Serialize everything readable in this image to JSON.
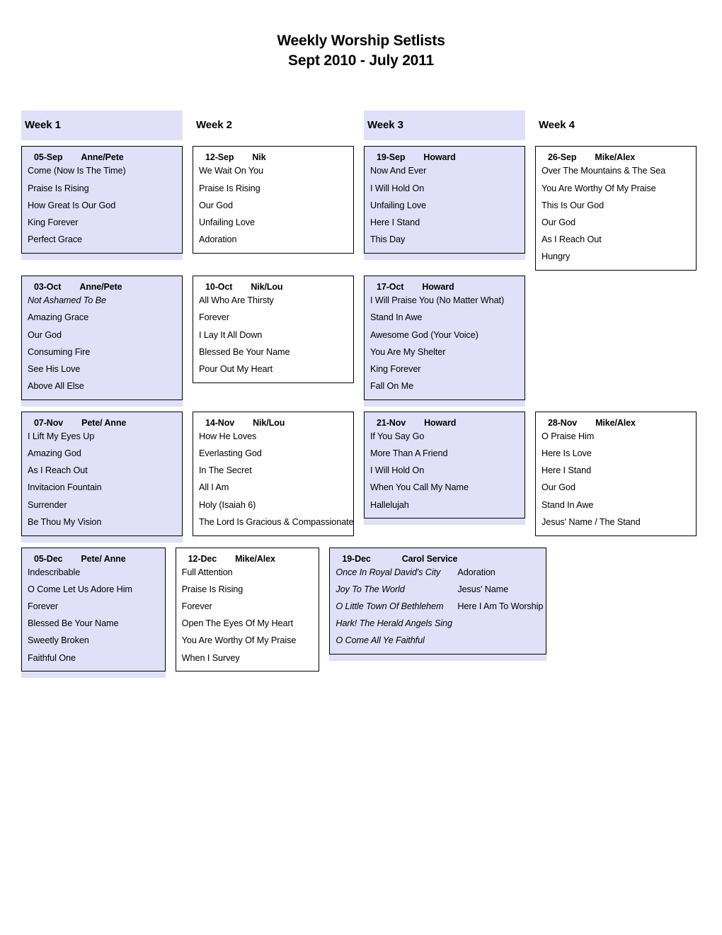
{
  "title": {
    "line1": "Weekly Worship Setlists",
    "line2": "Sept 2010 - July 2011"
  },
  "colors": {
    "shade": "#e0e0f8",
    "border": "#000000",
    "text": "#000000"
  },
  "week_headers": [
    {
      "label": "Week 1",
      "shaded": true
    },
    {
      "label": "Week 2",
      "shaded": false
    },
    {
      "label": "Week 3",
      "shaded": true
    },
    {
      "label": "Week 4",
      "shaded": false
    }
  ],
  "rows": [
    {
      "month": "September",
      "cards": [
        {
          "date": "05-Sep",
          "leader": "Anne/Pete",
          "shaded": true,
          "songs": [
            "Come (Now Is The Time)",
            "Praise Is Rising",
            "How Great Is Our God",
            "King Forever",
            "Perfect Grace"
          ]
        },
        {
          "date": "12-Sep",
          "leader": "Nik",
          "shaded": false,
          "songs": [
            "We Wait On You",
            "Praise Is Rising",
            "Our God",
            "Unfailing Love",
            "Adoration"
          ]
        },
        {
          "date": "19-Sep",
          "leader": "Howard",
          "shaded": true,
          "songs": [
            "Now And Ever",
            "I Will Hold On",
            "Unfailing Love",
            "Here I Stand",
            "This Day"
          ]
        },
        {
          "date": "26-Sep",
          "leader": "Mike/Alex",
          "shaded": false,
          "songs": [
            "Over The Mountains & The Sea",
            "You Are Worthy Of My Praise",
            "This Is Our God",
            "Our God",
            "As I Reach Out",
            "Hungry"
          ]
        }
      ]
    },
    {
      "month": "October",
      "cards": [
        {
          "date": "03-Oct",
          "leader": "Anne/Pete",
          "shaded": true,
          "songs": [
            "Not Ashamed To Be",
            "Amazing Grace",
            "Our God",
            "Consuming Fire",
            "See His Love",
            "Above All Else"
          ],
          "italic_songs": [
            "Not Ashamed To Be"
          ]
        },
        {
          "date": "10-Oct",
          "leader": "Nik/Lou",
          "shaded": false,
          "songs": [
            "All Who Are Thirsty",
            "Forever",
            "I Lay It All Down",
            "Blessed Be Your Name",
            "Pour Out My Heart"
          ]
        },
        {
          "date": "17-Oct",
          "leader": "Howard",
          "shaded": true,
          "songs": [
            "I Will Praise You (No Matter What)",
            "Stand In Awe",
            "Awesome God (Your Voice)",
            "You Are My Shelter",
            "King Forever",
            "Fall On Me"
          ]
        },
        null
      ]
    },
    {
      "month": "November",
      "cards": [
        {
          "date": "07-Nov",
          "leader": "Pete/ Anne",
          "shaded": true,
          "songs": [
            "I Lift My Eyes Up",
            "Amazing God",
            "As I Reach Out",
            "Invitacion Fountain",
            "Surrender",
            "Be Thou My Vision"
          ]
        },
        {
          "date": "14-Nov",
          "leader": "Nik/Lou",
          "shaded": false,
          "songs": [
            "How He Loves",
            "Everlasting God",
            "In The Secret",
            "All I Am",
            "Holy (Isaiah 6)",
            "The Lord Is Gracious & Compassionate"
          ]
        },
        {
          "date": "21-Nov",
          "leader": "Howard",
          "shaded": true,
          "songs": [
            "If You Say Go",
            "More Than A Friend",
            "I Will Hold On",
            "When You Call My Name",
            "Hallelujah"
          ]
        },
        {
          "date": "28-Nov",
          "leader": "Mike/Alex",
          "shaded": false,
          "songs": [
            "O Praise Him",
            "Here Is Love",
            "Here I Stand",
            "Our God",
            "Stand In Awe",
            "Jesus' Name / The Stand"
          ]
        }
      ]
    },
    {
      "month": "December",
      "cards": [
        {
          "date": "05-Dec",
          "leader": "Pete/ Anne",
          "shaded": true,
          "songs": [
            "Indescribable",
            "O Come Let Us Adore Him",
            "Forever",
            "Blessed Be Your Name",
            "Sweetly Broken",
            "Faithful One"
          ]
        },
        {
          "date": "12-Dec",
          "leader": "Mike/Alex",
          "shaded": false,
          "songs": [
            "Full Attention",
            "Praise Is Rising",
            "Forever",
            "Open The Eyes Of My Heart",
            "You Are Worthy Of My Praise",
            "When I Survey"
          ]
        },
        {
          "date": "19-Dec",
          "leader": "Carol Service",
          "shaded": true,
          "wide": true,
          "wide_leader_gap": true,
          "songs_col_a": [
            "Once In Royal David's City",
            "Joy To The World",
            "O Little Town Of Bethlehem",
            "Hark! The Herald Angels Sing",
            "O Come All Ye Faithful"
          ],
          "songs_col_a_italic": true,
          "songs_col_b": [
            "Adoration",
            "Jesus' Name",
            "Here I Am To Worship"
          ]
        },
        null
      ]
    }
  ]
}
